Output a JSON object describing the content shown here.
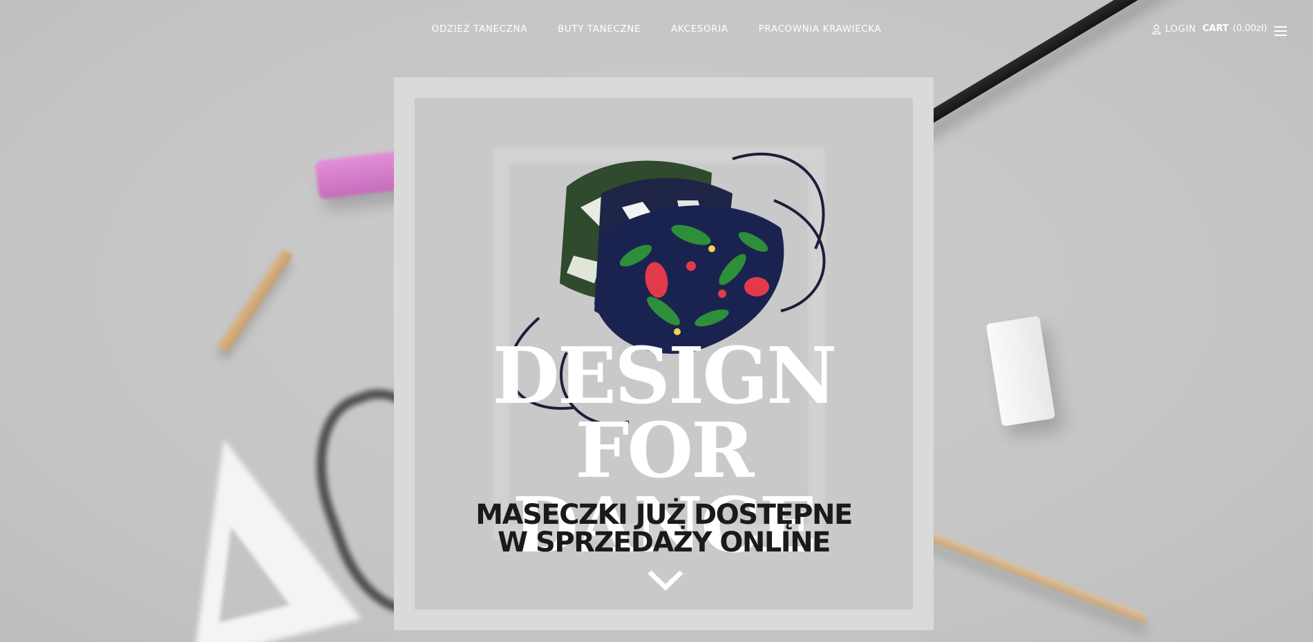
{
  "nav": {
    "items": [
      {
        "label": "ODZIEŻ TANECZNA"
      },
      {
        "label": "BUTY TANECZNE"
      },
      {
        "label": "AKCESORIA"
      },
      {
        "label": "PRACOWNIA KRAWIECKA"
      }
    ]
  },
  "account": {
    "login_label": "LOGIN"
  },
  "cart": {
    "label": "CART",
    "amount": "(0.00zł)"
  },
  "hero": {
    "title_line1": "DESIGN",
    "title_line2": "FOR DANCE",
    "subtitle_line1": "MASECZKI JUŻ DOSTĘPNE",
    "subtitle_line2": "W SPRZEDAŻY ONLINE"
  },
  "icons": {
    "user": "user-icon",
    "menu": "hamburger-menu-icon",
    "scroll": "chevron-down-icon"
  },
  "colors": {
    "background": "#c8c8c8",
    "frame": "#dadada",
    "text_light": "#ffffff",
    "text_dark": "#1a1a1a"
  }
}
